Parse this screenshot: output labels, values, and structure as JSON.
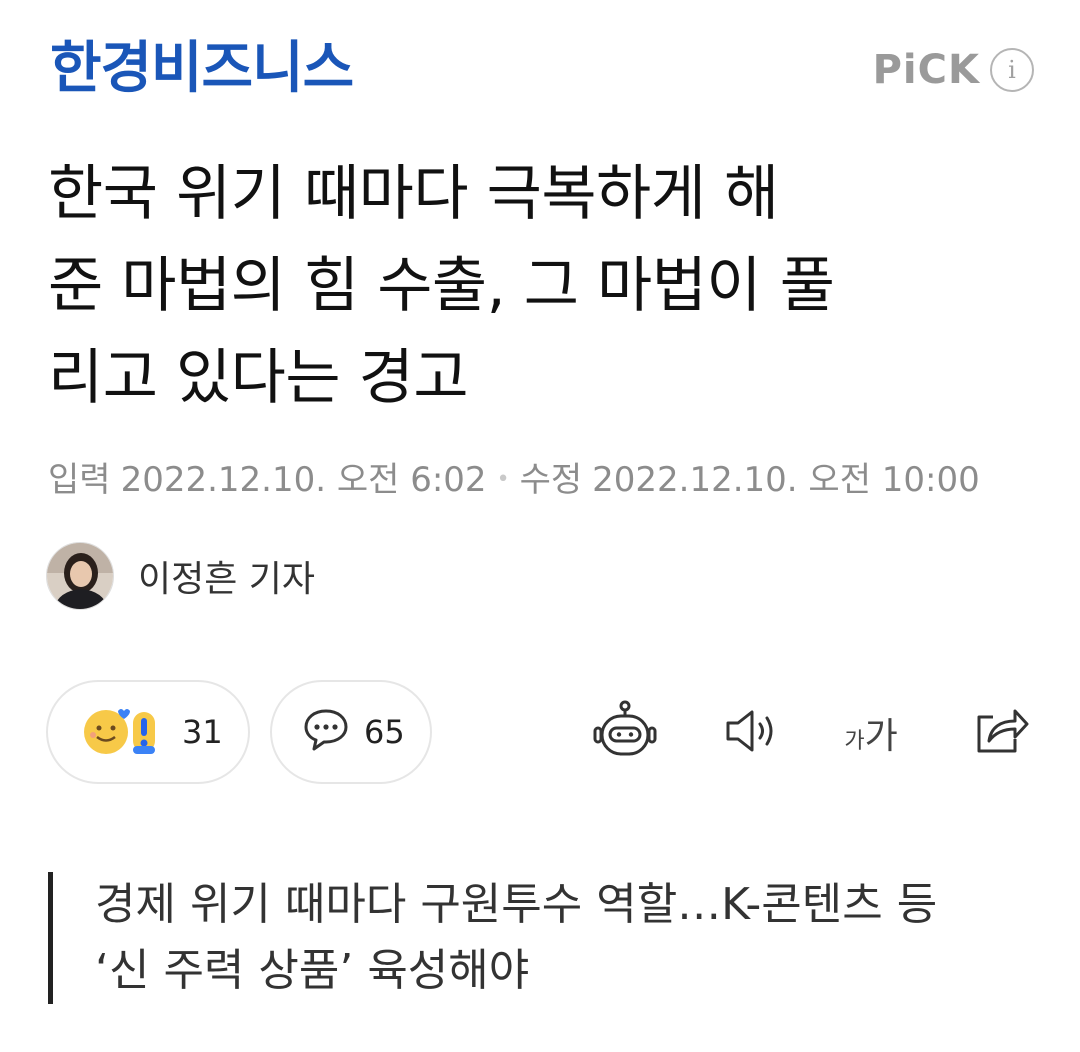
{
  "header": {
    "logo_text": "한경비즈니스",
    "pick_label": "PiCK",
    "info_glyph": "i"
  },
  "article": {
    "headline_lines": [
      "한국 위기 때마다 극복하게 해",
      "준 마법의 힘 수출, 그 마법이 풀",
      "리고 있다는 경고"
    ],
    "published_label": "입력",
    "published_time": "2022.12.10. 오전 6:02",
    "modified_label": "수정",
    "modified_time": "2022.12.10. 오전 10:00",
    "reporter": "이정흔 기자",
    "subheadline_lines": [
      "경제 위기 때마다 구원투수 역할…K-콘텐츠 등",
      "‘신 주력 상품’ 육성해야"
    ]
  },
  "actions": {
    "reaction_count": "31",
    "comment_count": "65",
    "font_small": "가",
    "font_large": "가"
  },
  "icons": [
    "info-icon",
    "reaction-emoji-icon",
    "comment-icon",
    "summary-bot-icon",
    "speaker-icon",
    "font-size-icon",
    "share-icon"
  ],
  "colors": {
    "brand": "#1a56b8",
    "meta_text": "#8c8c8c",
    "border": "#e6e6e6"
  }
}
